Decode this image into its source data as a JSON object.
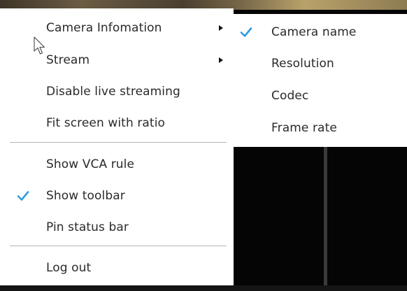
{
  "menu": {
    "items": [
      {
        "label": "Camera Infomation",
        "checked": false,
        "has_submenu": true
      },
      {
        "label": "Stream",
        "checked": false,
        "has_submenu": true
      },
      {
        "label": "Disable live streaming",
        "checked": false,
        "has_submenu": false
      },
      {
        "label": "Fit screen with ratio",
        "checked": false,
        "has_submenu": false
      },
      {
        "label": "Show VCA rule",
        "checked": false,
        "has_submenu": false
      },
      {
        "label": "Show toolbar",
        "checked": true,
        "has_submenu": false
      },
      {
        "label": "Pin status bar",
        "checked": false,
        "has_submenu": false
      },
      {
        "label": "Log out",
        "checked": false,
        "has_submenu": false
      }
    ]
  },
  "submenu": {
    "parent": "Camera Infomation",
    "items": [
      {
        "label": "Camera name",
        "checked": true
      },
      {
        "label": "Resolution",
        "checked": false
      },
      {
        "label": "Codec",
        "checked": false
      },
      {
        "label": "Frame rate",
        "checked": false
      }
    ]
  },
  "icons": {
    "check": "checkmark-icon",
    "submenu_arrow": "caret-right-icon",
    "cursor": "mouse-pointer-icon"
  },
  "colors": {
    "check_accent": "#2f9be0",
    "menu_background": "#ffffff",
    "text": "#2a2a2a",
    "separator": "#b5b5b5",
    "video_background": "#050505"
  }
}
